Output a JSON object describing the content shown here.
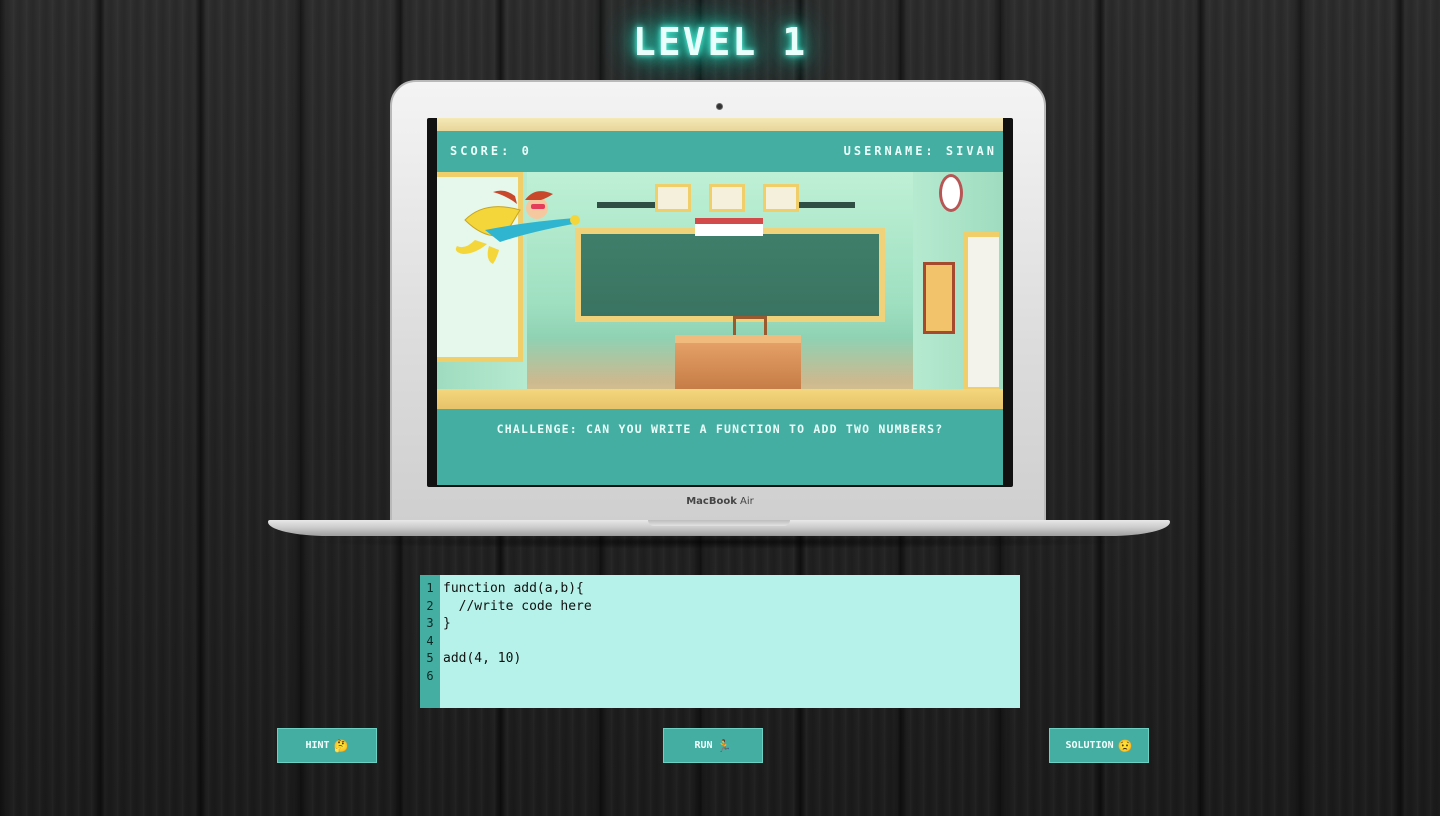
{
  "header": {
    "title": "LEVEL 1"
  },
  "laptop": {
    "brand": "MacBook",
    "model": "Air",
    "screen": {
      "score_label": "SCORE: 0",
      "username_label": "USERNAME: SIVAN",
      "challenge": "CHALLENGE: CAN YOU WRITE A FUNCTION TO ADD TWO NUMBERS?"
    }
  },
  "editor": {
    "line_numbers": [
      "1",
      "2",
      "3",
      "4",
      "5",
      "6"
    ],
    "lines": [
      "function add(a,b){",
      "  //write code here",
      "}",
      "",
      "add(4, 10)",
      ""
    ]
  },
  "buttons": {
    "hint": {
      "label": "HINT",
      "emoji": "🤔"
    },
    "run": {
      "label": "RUN",
      "emoji": "🏃"
    },
    "solution": {
      "label": "SOLUTION",
      "emoji": "😟"
    }
  },
  "colors": {
    "accent": "#45aea2",
    "editor_bg": "#b6f2e9",
    "glow": "#29e3c7"
  }
}
